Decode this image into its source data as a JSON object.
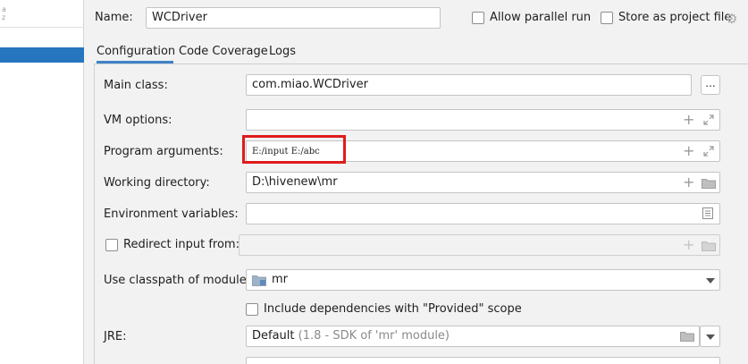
{
  "header": {
    "name_label": "Name:",
    "name_value": "WCDriver",
    "allow_parallel_run_label": "Allow parallel run",
    "store_as_project_file_label": "Store as project file"
  },
  "tabs": [
    {
      "label": "Configuration"
    },
    {
      "label": "Code Coverage"
    },
    {
      "label": "Logs"
    }
  ],
  "form": {
    "main_class_label": "Main class:",
    "main_class_value": "com.miao.WCDriver",
    "browse_label": "...",
    "vm_options_label": "VM options:",
    "vm_options_value": "",
    "program_arguments_label": "Program arguments:",
    "program_arguments_value": "E:/input E:/abc",
    "working_directory_label": "Working directory:",
    "working_directory_value": "D:\\hivenew\\mr",
    "environment_variables_label": "Environment variables:",
    "environment_variables_value": "",
    "redirect_input_label": "Redirect input from:",
    "classpath_module_label": "Use classpath of module:",
    "classpath_module_value": "mr",
    "include_provided_label": "Include dependencies with \"Provided\" scope",
    "jre_label": "JRE:",
    "jre_value": "Default",
    "jre_detail": "(1.8 - SDK of 'mr' module)"
  },
  "colors": {
    "selection": "#2675bf",
    "highlight_box": "#e01b1b",
    "tab_accent": "#4083c9"
  },
  "icons": [
    "gear-icon",
    "plus-icon",
    "expand-icon",
    "folder-icon",
    "list-icon",
    "module-icon",
    "chevron-down-icon"
  ]
}
